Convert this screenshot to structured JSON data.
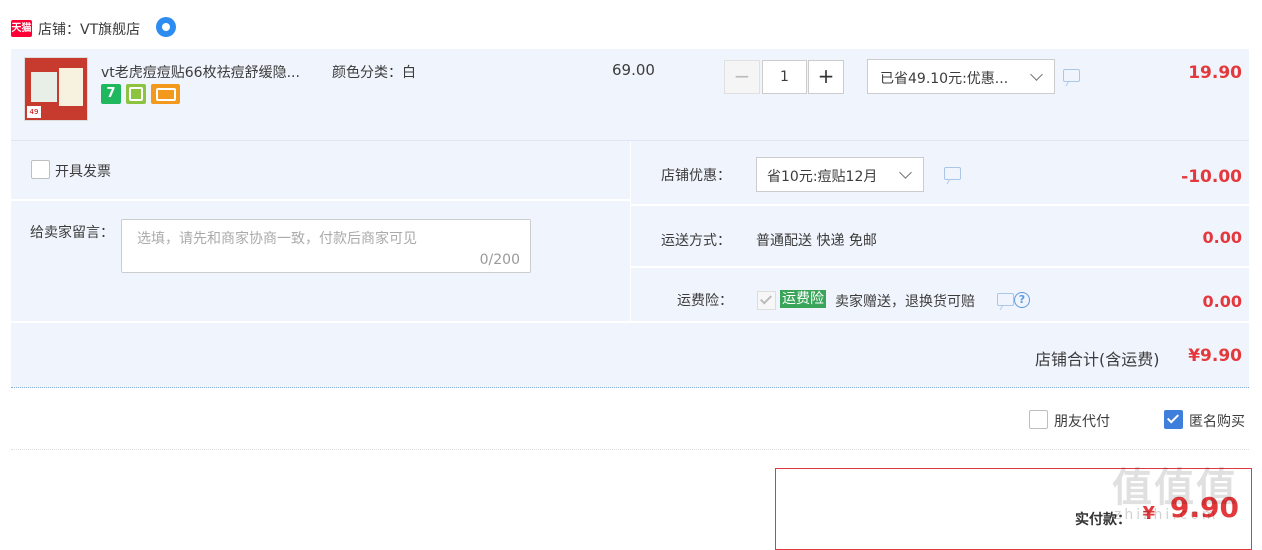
{
  "shop": {
    "badge_text": "天猫",
    "label": "店铺：VT旗舰店"
  },
  "item": {
    "title": "vt老虎痘痘贴66枚祛痘舒缓隐...",
    "sku": "颜色分类：白",
    "price": "69.00",
    "qty_minus": "−",
    "quantity": "1",
    "qty_plus": "+",
    "promo": "已省49.10元:优惠...",
    "subtotal": "19.90",
    "thumb_text": "49",
    "badges": [
      "7",
      "",
      ""
    ]
  },
  "invoice": {
    "label": "开具发票"
  },
  "note": {
    "label": "给卖家留言：",
    "placeholder": "选填，请先和商家协商一致，付款后商家可见",
    "count": "0/200"
  },
  "shop_discount": {
    "label": "店铺优惠：",
    "selected": "省10元:痘贴12月",
    "amount": "-10.00"
  },
  "shipping": {
    "label": "运送方式：",
    "method": "普通配送 快递 免邮",
    "amount": "0.00"
  },
  "insurance": {
    "label": "运费险：",
    "tag": "运费险",
    "desc": "卖家赠送，退换货可赔",
    "help": "?",
    "amount": "0.00"
  },
  "shop_total": {
    "label": "店铺合计(含运费)",
    "amount": "¥9.90"
  },
  "options": {
    "friend_pay": "朋友代付",
    "anonymous": "匿名购买"
  },
  "payment": {
    "label": "实付款：",
    "currency": "¥",
    "amount": "9.90"
  },
  "watermark": {
    "glyphs": "值值值",
    "site": "zhizhi.com"
  },
  "colors": {
    "accent_red": "#e4393c",
    "panel_bg": "#f0f4fd",
    "check_blue": "#3e7fdc",
    "insurance_green": "#3aa55a"
  }
}
